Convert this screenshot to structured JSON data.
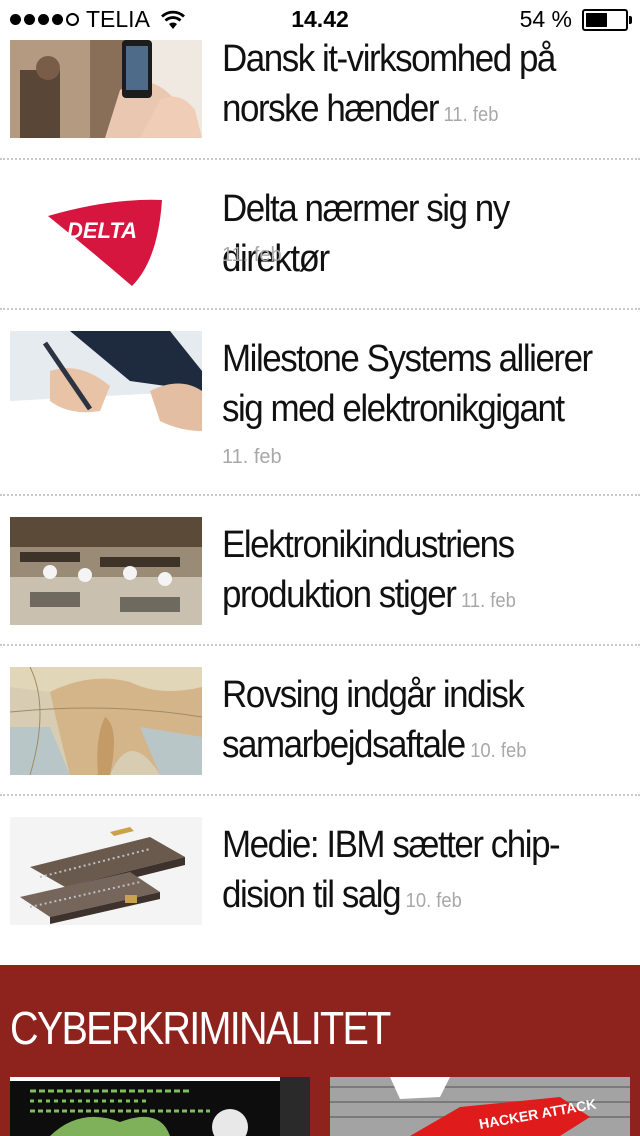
{
  "status_bar": {
    "carrier": "TELIA",
    "time": "14.42",
    "battery_percent": "54 %",
    "signal_bars_filled": 4,
    "signal_bars_total": 5,
    "battery_level": 0.54
  },
  "articles": [
    {
      "title": "Dansk it-virksomhed på norske hænder",
      "date": "11. feb",
      "image": "hands-tablet-photo"
    },
    {
      "title": "Delta nærmer sig ny direktør",
      "date": "11. feb",
      "image": "delta-logo",
      "logo_text": "DELTA"
    },
    {
      "title": "Milestone Systems allierer sig med elektronikgigant",
      "date": "11. feb",
      "image": "hand-writing-photo"
    },
    {
      "title": "Elektronikindustriens produktion stiger",
      "date": "11. feb",
      "image": "factory-photo"
    },
    {
      "title": "Rovsing indgår indisk samarbejdsaftale",
      "date": "10. feb",
      "image": "india-map-photo"
    },
    {
      "title": "Medie: IBM sætter chip-dision til salg",
      "date": "10. feb",
      "image": "chips-photo"
    }
  ],
  "section": {
    "title": "CYBERKRIMINALITET",
    "color": "#8d231c"
  }
}
